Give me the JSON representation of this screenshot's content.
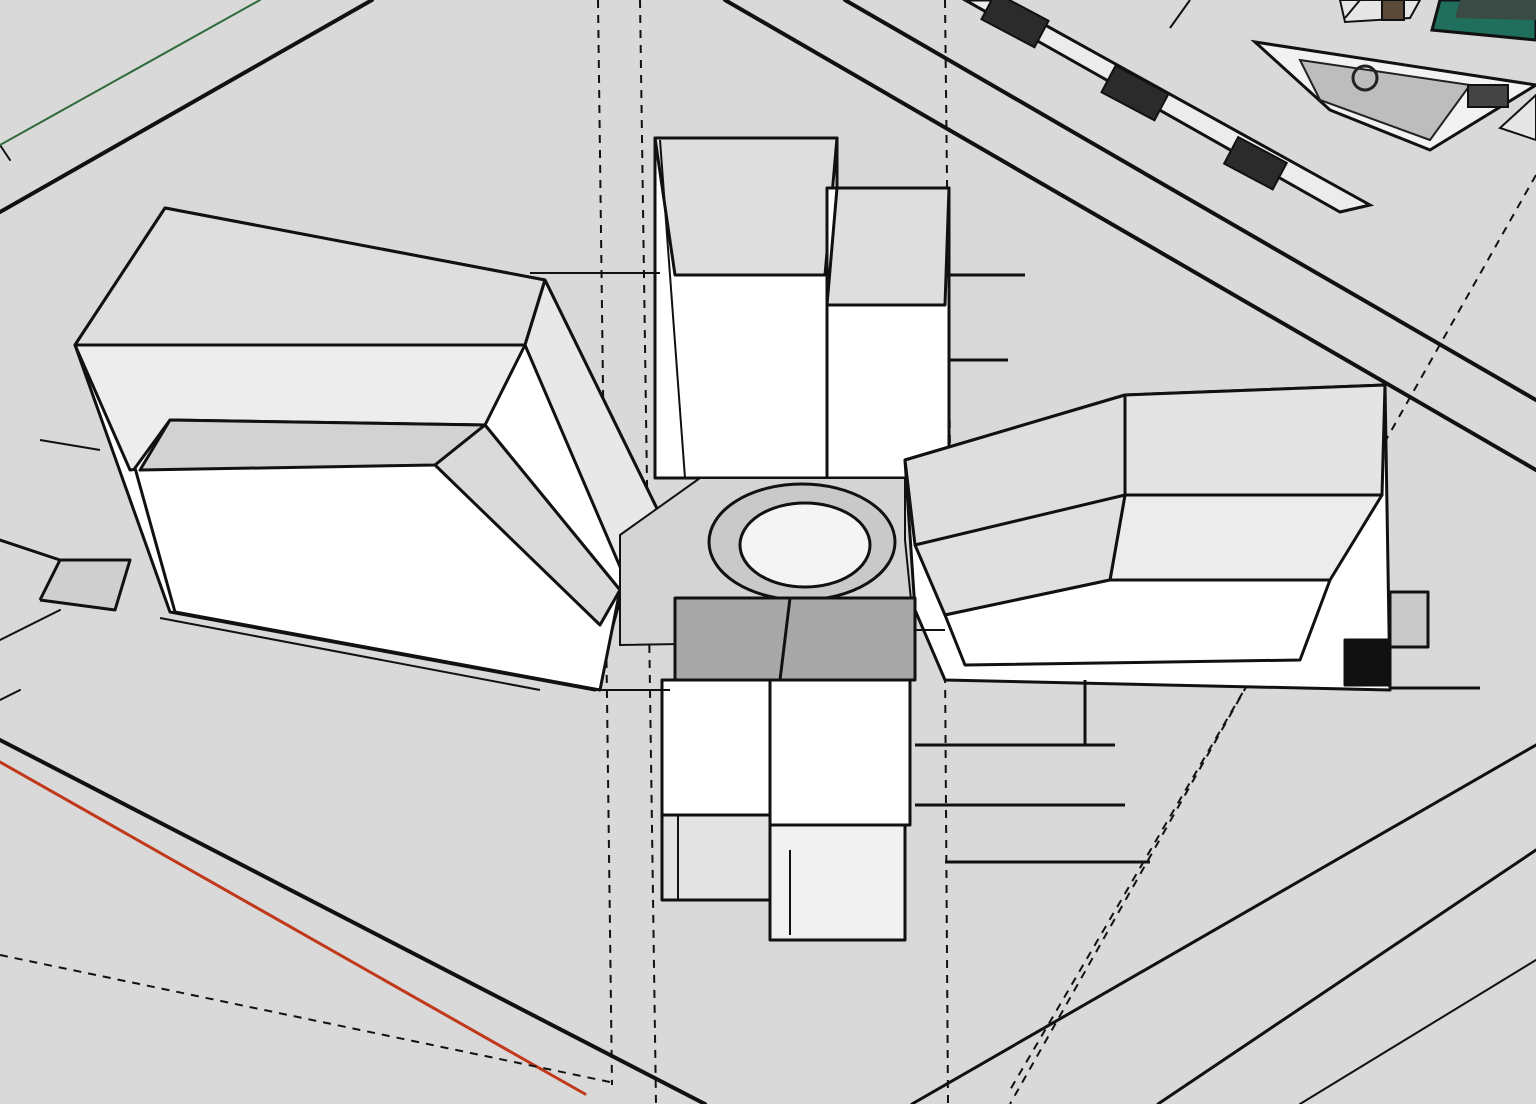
{
  "drawing": {
    "kind": "axonometric building massing sketch",
    "palette": {
      "background": "#d9d9d9",
      "wall_face": "#ffffff",
      "roof_face": "#dedede",
      "shaded_roof": "#a8a8a8",
      "ink": "#111111",
      "accent_red": "#c0391b",
      "accent_green": "#2f6b3a",
      "tile_dark": "#3a4a44",
      "tile_teal": "#1f6f5c"
    },
    "components": [
      "site-boundary-lines",
      "dashed-setback-lines",
      "west-wing-building",
      "north-tower-building",
      "east-wing-building",
      "south-block-building",
      "central-plaza-circle",
      "street-furniture-north",
      "context-image-tiles"
    ]
  }
}
